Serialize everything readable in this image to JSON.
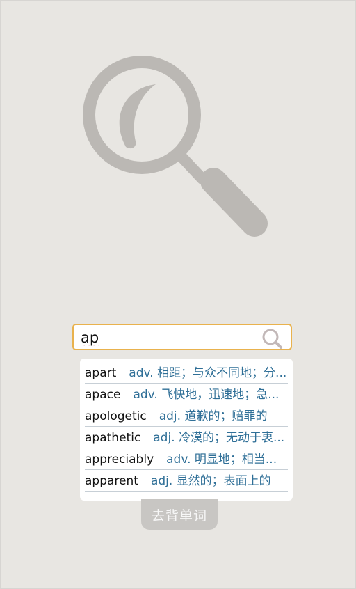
{
  "search": {
    "value": "ap",
    "placeholder": ""
  },
  "icons": {
    "hero": "magnifier-illustration",
    "search": "search-icon"
  },
  "suggestions": [
    {
      "word": "apart",
      "meaning": "adv. 相距；与众不同地；分..."
    },
    {
      "word": "apace",
      "meaning": "adv. 飞快地，迅速地；急..."
    },
    {
      "word": "apologetic",
      "meaning": "adj. 道歉的；赔罪的"
    },
    {
      "word": "apathetic",
      "meaning": "adj. 冷漠的；无动于衷..."
    },
    {
      "word": "appreciably",
      "meaning": "adv. 明显地；相当..."
    },
    {
      "word": "apparent",
      "meaning": "adj. 显然的；表面上的"
    }
  ],
  "action": {
    "label": "去背单词"
  },
  "colors": {
    "background": "#e8e6e2",
    "search_border": "#e9b24d",
    "meaning_text": "#2f6f97",
    "button_bg": "#c8c6c3",
    "icon_gray": "#bbb8b4"
  }
}
